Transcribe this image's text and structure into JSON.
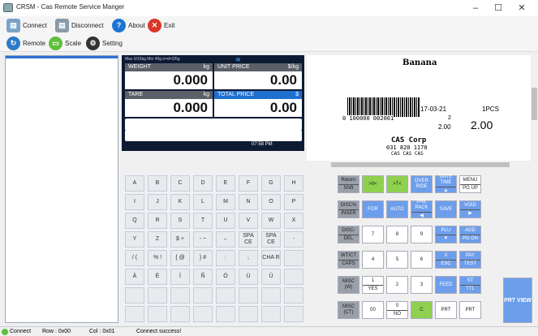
{
  "window": {
    "title": "CRSM - Cas Remote Service Manger",
    "minimize": "–",
    "maximize": "☐",
    "close": "✕"
  },
  "toolbar1": {
    "connect": "Connect",
    "disconnect": "Disconnect",
    "about": "About",
    "exit": "Exit"
  },
  "toolbar2": {
    "remote": "Remote",
    "scale": "Scale",
    "setting": "Setting"
  },
  "lcd": {
    "info": "Max 6/15kg Min 40g e=d=2/5g",
    "weight_label": "WEIGHT",
    "weight_unit": "kg",
    "weight_value": "0.000",
    "unit_price_label": "UNIT PRICE",
    "unit_price_unit": "$/kg",
    "unit_price_value": "0.00",
    "tare_label": "TARE",
    "tare_unit": "kg",
    "tare_value": "0.000",
    "total_label": "TOTAL PRICE",
    "total_unit": "$",
    "total_value": "0.00",
    "time": "07:58 PM"
  },
  "label": {
    "product": "Banana",
    "date": "17-03-21",
    "qty": "1PCS",
    "n2": "2",
    "price_small": "2.00",
    "price_big": "2.00",
    "barcode": "0 100000 002001",
    "company": "CAS Corp",
    "phone": "031 820 1170",
    "footer": "CAS CAS CAS"
  },
  "keys": [
    [
      "A",
      "B",
      "C",
      "D",
      "E",
      "F",
      "G",
      "H"
    ],
    [
      "I",
      "J",
      "K",
      "L",
      "M",
      "N",
      "O",
      "P"
    ],
    [
      "Q",
      "R",
      "S",
      "T",
      "U",
      "V",
      "W",
      "X"
    ],
    [
      "Y",
      "Z",
      "$ +",
      "- ~",
      "←",
      "SPA CE",
      "SPA CE",
      "-"
    ],
    [
      "/ (",
      "% !",
      "{ @",
      "} #",
      ":",
      ";",
      "CHA R",
      ""
    ],
    [
      "À",
      "É",
      "Ì",
      "Ñ",
      "Ò",
      "Ù",
      "Ü",
      ""
    ],
    [
      "",
      "",
      "",
      "",
      "",
      "",
      "",
      ""
    ],
    [
      "",
      "",
      "",
      "",
      "",
      "",
      "",
      ""
    ]
  ],
  "fkeys": [
    [
      {
        "t": "Return",
        "b": "Shift",
        "c": "gray"
      },
      {
        "t": ">0<",
        "c": "green"
      },
      {
        "t": ">T<",
        "c": "green"
      },
      {
        "t": "OVER RIDE",
        "c": "blue"
      },
      {
        "t": "DATE TIME",
        "b": "▲",
        "c": "blue"
      },
      {
        "t": "MENU",
        "b": "PG UP",
        "c": "white"
      }
    ],
    [
      {
        "t": "DISC%",
        "b": "INSER",
        "c": "gray"
      },
      {
        "t": "FOR",
        "c": "blue"
      },
      {
        "t": "AUTO",
        "c": "blue"
      },
      {
        "t": "PRE PACK",
        "b": "◀",
        "c": "blue"
      },
      {
        "t": "SAVE",
        "c": "blue"
      },
      {
        "t": "VOID",
        "b": "▶",
        "c": "blue"
      }
    ],
    [
      {
        "t": "DISC-",
        "b": "DEL",
        "c": "gray"
      },
      {
        "t": "7",
        "c": "white"
      },
      {
        "t": "8",
        "c": "white"
      },
      {
        "t": "9",
        "c": "white"
      },
      {
        "t": "PLU",
        "b": "▼",
        "c": "blue"
      },
      {
        "t": "ADD",
        "b": "PG DN",
        "c": "blue"
      }
    ],
    [
      {
        "t": "WT/CT",
        "b": "CAPS",
        "c": "gray"
      },
      {
        "t": "4",
        "c": "white"
      },
      {
        "t": "5",
        "c": "white"
      },
      {
        "t": "6",
        "c": "white"
      },
      {
        "t": "X",
        "b": "ESC",
        "c": "blue"
      },
      {
        "t": "PAY",
        "b": "TEST",
        "c": "blue"
      }
    ],
    [
      {
        "t": "MISC (W)",
        "c": "gray"
      },
      {
        "t": "1",
        "b": "YES",
        "c": "white"
      },
      {
        "t": "2",
        "c": "white"
      },
      {
        "t": "3",
        "c": "white"
      },
      {
        "t": "FEED",
        "c": "blue"
      },
      {
        "t": "ST",
        "b": "TTL",
        "c": "blue"
      }
    ],
    [
      {
        "t": "MISC (CT)",
        "c": "gray"
      },
      {
        "t": "00",
        "c": "white"
      },
      {
        "t": "0",
        "b": "NO",
        "c": "white"
      },
      {
        "t": "C",
        "c": "green"
      },
      {
        "t": "PRT",
        "c": "white"
      },
      {
        "t": "PRT",
        "c": "white"
      }
    ]
  ],
  "prtview": "PRT VIEW",
  "status": {
    "connect": "Connect",
    "row": "Row : 0x00",
    "col": "Col : 0x01",
    "msg": "Connect success!"
  }
}
